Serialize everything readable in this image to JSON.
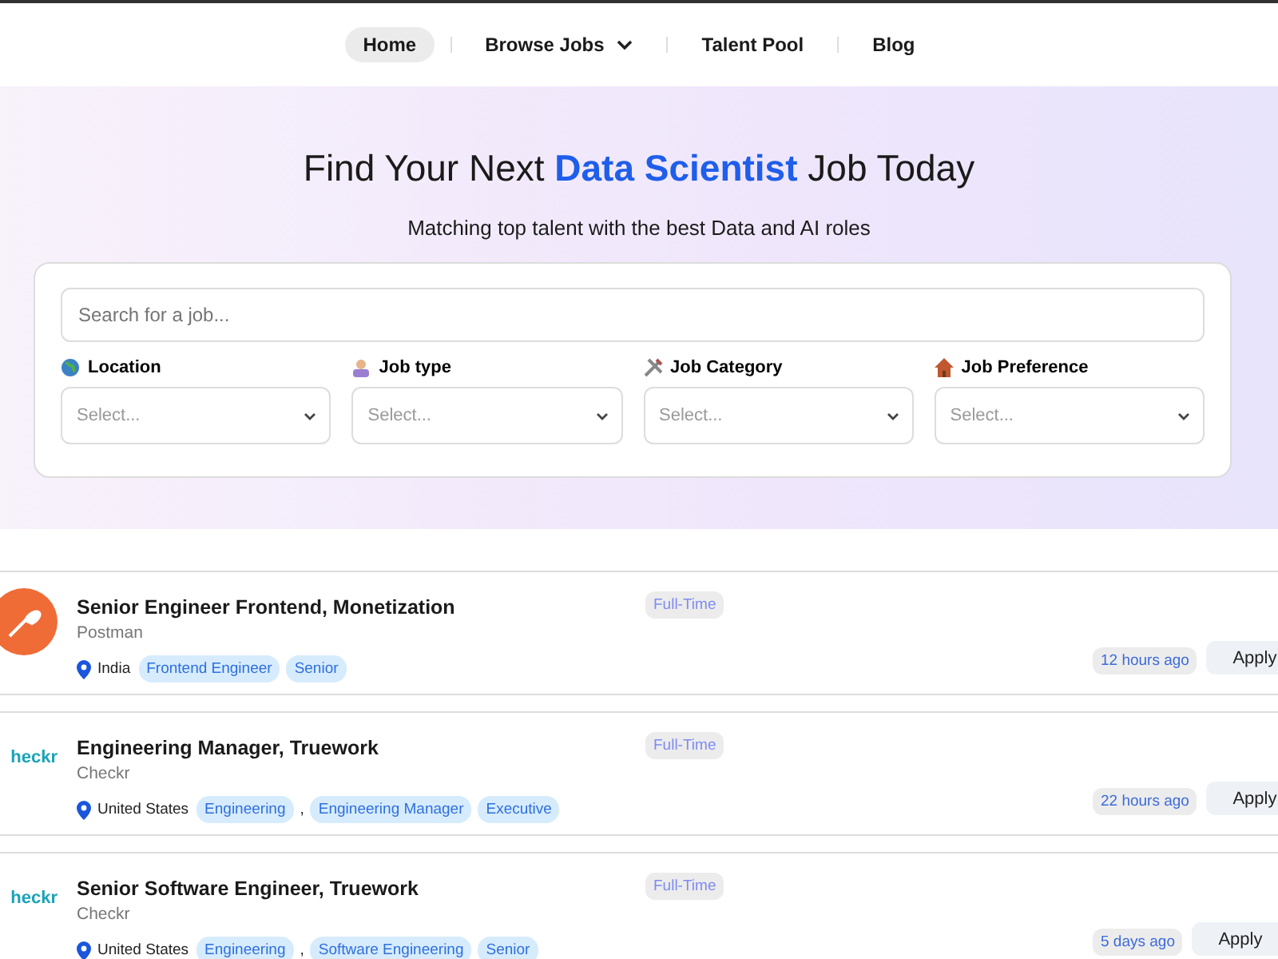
{
  "nav": {
    "items": [
      {
        "label": "Home",
        "selected": true,
        "dropdown": false
      },
      {
        "label": "Browse Jobs",
        "selected": false,
        "dropdown": true
      },
      {
        "label": "Talent Pool",
        "selected": false,
        "dropdown": false
      },
      {
        "label": "Blog",
        "selected": false,
        "dropdown": false
      }
    ]
  },
  "hero": {
    "title": "Find Your Next **Data Scientist** Job Today",
    "subtitle": "Matching top talent with the best Data and AI roles"
  },
  "search": {
    "placeholder": "Search for a job...",
    "filters": [
      {
        "kind": "globe",
        "label": "Location",
        "placeholder": "Select..."
      },
      {
        "kind": "person",
        "label": "Job type",
        "placeholder": "Select..."
      },
      {
        "kind": "tools",
        "label": "Job Category",
        "placeholder": "Select..."
      },
      {
        "kind": "house",
        "label": "Job Preference",
        "placeholder": "Select..."
      }
    ]
  },
  "jobs": [
    {
      "kind": "circle-logo",
      "title": "Senior Engineer Frontend, Monetization",
      "company": "Postman",
      "location": "India",
      "type": "Full-Time",
      "posted": "12 hours ago",
      "action": "Apply",
      "tags": [
        {
          "kind": "tag",
          "text": "Frontend Engineer"
        },
        {
          "kind": "tag",
          "text": "Senior"
        }
      ]
    },
    {
      "kind": "wordmark-logo",
      "logo_text": "heckr",
      "title": "Engineering Manager, Truework",
      "company": "Checkr",
      "location": "United States",
      "type": "Full-Time",
      "posted": "22 hours ago",
      "action": "Apply",
      "tags": [
        {
          "kind": "tag",
          "text": "Engineering"
        },
        {
          "kind": "separator",
          "text": ","
        },
        {
          "kind": "tag",
          "text": "Engineering Manager"
        },
        {
          "kind": "tag",
          "text": "Executive"
        }
      ]
    },
    {
      "kind": "wordmark-logo",
      "logo_text": "heckr",
      "title": "Senior Software Engineer, Truework",
      "company": "Checkr",
      "location": "United States",
      "type": "Full-Time",
      "posted": "5 days ago",
      "action": "Apply",
      "tags": [
        {
          "kind": "tag",
          "text": "Engineering"
        },
        {
          "kind": "separator",
          "text": ","
        },
        {
          "kind": "tag",
          "text": "Software Engineering"
        },
        {
          "kind": "tag",
          "text": "Senior"
        }
      ]
    }
  ]
}
